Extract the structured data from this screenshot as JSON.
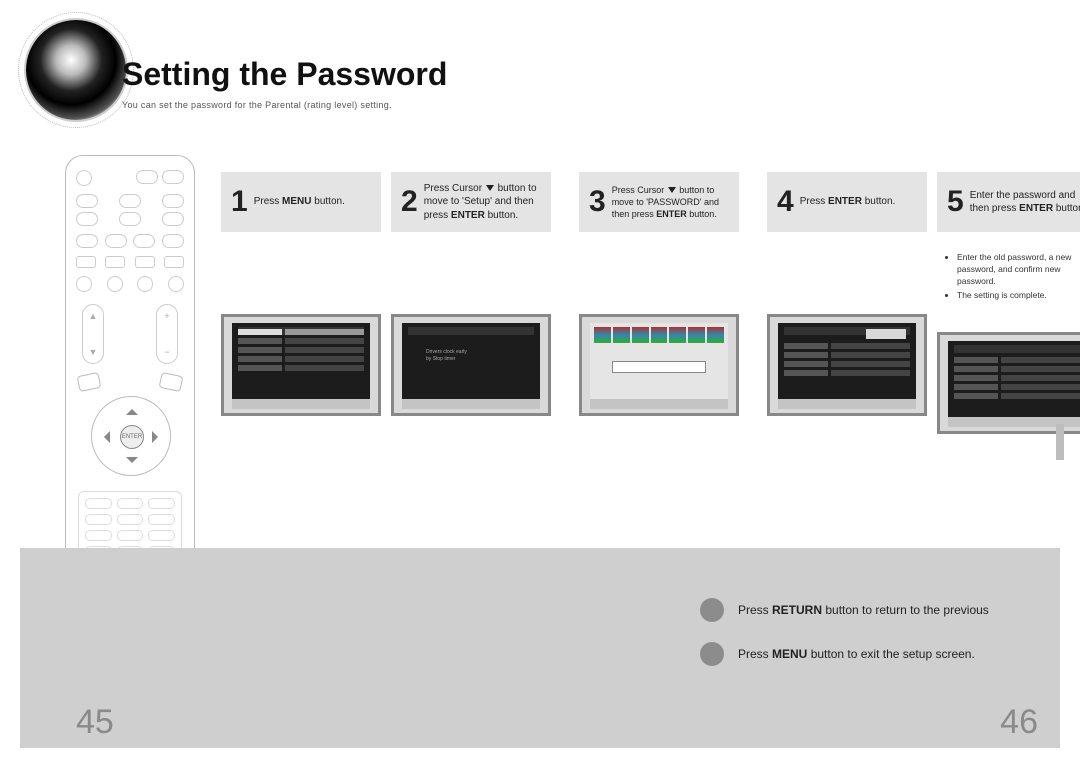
{
  "header": {
    "title": "Setting the Password",
    "subtitle": "You can set the password for the Parental (rating level) setting."
  },
  "steps": [
    {
      "num": "1",
      "text_html": "Press <b>MENU</b> button."
    },
    {
      "num": "2",
      "text_html": "Press Cursor <span class='caret'></span> button to move to 'Setup' and then press <b>ENTER</b> button."
    },
    {
      "num": "3",
      "text_html": "Press Cursor <span class='caret'></span> button to move to 'PASSWORD' and then press <b>ENTER</b> button."
    },
    {
      "num": "4",
      "text_html": "Press <b>ENTER</b> button."
    },
    {
      "num": "5",
      "text_html": "Enter the password and then press <b>ENTER</b> button."
    }
  ],
  "step5_notes": [
    "Enter the old password, a new password, and confirm new password.",
    "The setting is complete."
  ],
  "tips": [
    {
      "text_html": "Press <b>RETURN</b> button to return to the previous"
    },
    {
      "text_html": "Press <b>MENU</b> button to exit the setup screen."
    }
  ],
  "pages": {
    "left": "45",
    "right": "46"
  },
  "remote": {
    "enter_label": "ENTER"
  }
}
